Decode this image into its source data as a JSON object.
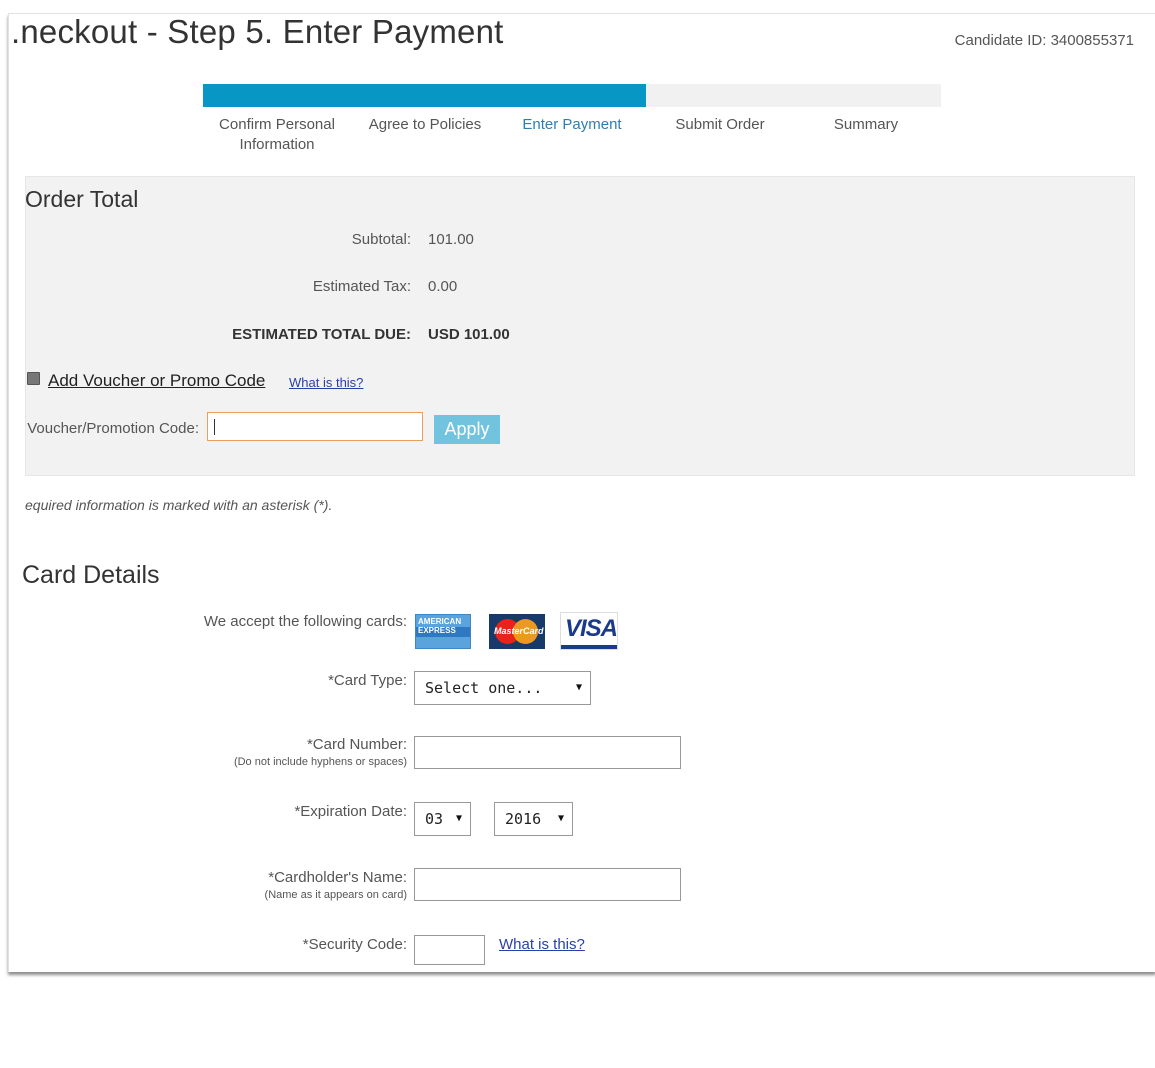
{
  "header": {
    "title": ".neckout - Step 5. Enter Payment",
    "candidate_label": "Candidate ID:",
    "candidate_id": "3400855371"
  },
  "progress": {
    "percent_complete": 60,
    "steps": [
      {
        "label": "Confirm Personal Information",
        "state": "done"
      },
      {
        "label": "Agree to Policies",
        "state": "done"
      },
      {
        "label": "Enter Payment",
        "state": "active"
      },
      {
        "label": "Submit Order",
        "state": "pending"
      },
      {
        "label": "Summary",
        "state": "pending"
      }
    ]
  },
  "order": {
    "title": "Order Total",
    "subtotal_label": "Subtotal:",
    "subtotal": "101.00",
    "tax_label": "Estimated Tax:",
    "tax": "0.00",
    "total_label": "ESTIMATED TOTAL DUE:",
    "total": "USD 101.00"
  },
  "voucher": {
    "toggle_label": "Add Voucher or Promo Code",
    "help_link": "What is this?",
    "field_label": "Voucher/Promotion Code:",
    "field_value": "",
    "apply_label": "Apply"
  },
  "required_note": "equired information is marked with an asterisk (*).",
  "card": {
    "title": "Card Details",
    "accept_label": "We accept the following cards:",
    "logos": [
      {
        "name": "amex",
        "text": "AMERICAN EXPRESS"
      },
      {
        "name": "mastercard",
        "text": "MasterCard"
      },
      {
        "name": "visa",
        "text": "VISA"
      }
    ],
    "type_label": "*Card Type:",
    "type_value": "Select one...",
    "number_label": "*Card Number:",
    "number_sub": "(Do not include hyphens or spaces)",
    "number_value": "",
    "exp_label": "*Expiration Date:",
    "exp_month": "03",
    "exp_year": "2016",
    "name_label": "*Cardholder's Name:",
    "name_sub": "(Name as it appears on card)",
    "name_value": "",
    "security_label": "*Security Code:",
    "security_value": "",
    "security_help": "What is this?"
  },
  "colors": {
    "progress_fill": "#0896c5",
    "active_step": "#2c7fb4",
    "apply_button": "#72c3de",
    "link": "#2a3fa6",
    "focus_border": "#e8a060"
  }
}
